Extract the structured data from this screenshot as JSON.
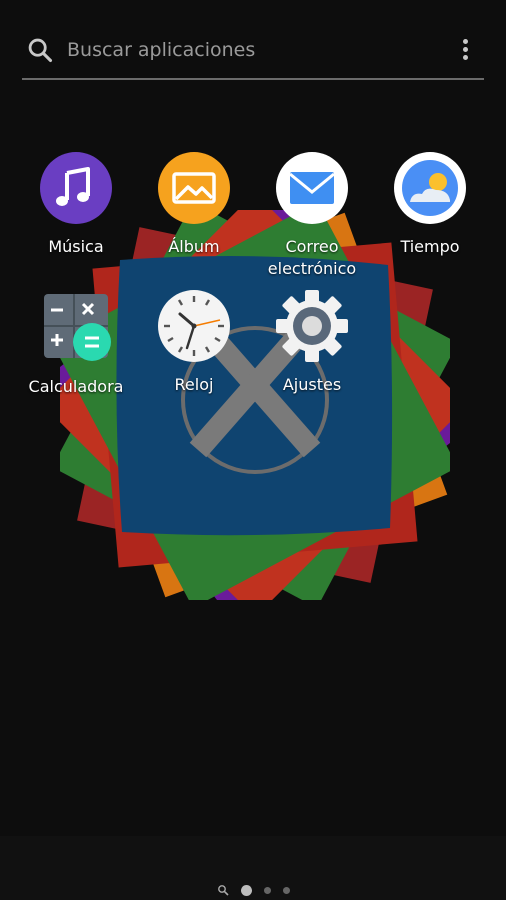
{
  "search": {
    "placeholder": "Buscar aplicaciones"
  },
  "apps": [
    {
      "label": "Música",
      "icon": "music-icon",
      "color": "#6a3ec2"
    },
    {
      "label": "Álbum",
      "icon": "album-icon",
      "color": "#f6a21e"
    },
    {
      "label": "Correo electrónico",
      "label_line1": "Correo",
      "label_line2": "electrónico",
      "icon": "email-icon",
      "color": "#3f8ff2"
    },
    {
      "label": "Tiempo",
      "icon": "weather-icon",
      "color": "#4a8ff5"
    },
    {
      "label": "Calculadora",
      "icon": "calculator-icon",
      "color": "#2ad9b0"
    },
    {
      "label": "Reloj",
      "icon": "clock-icon",
      "color": "#ffffff"
    },
    {
      "label": "Ajustes",
      "icon": "settings-icon",
      "color": "#59687a"
    }
  ],
  "page_indicator": {
    "pages": 3,
    "active": 1
  },
  "colors": {
    "background": "#0d0d0d",
    "wallpaper_card": "#0f4470",
    "petals": [
      "#9b2424",
      "#c0321f",
      "#2e7d32",
      "#6a1b9a",
      "#d87512",
      "#b0261c"
    ]
  }
}
